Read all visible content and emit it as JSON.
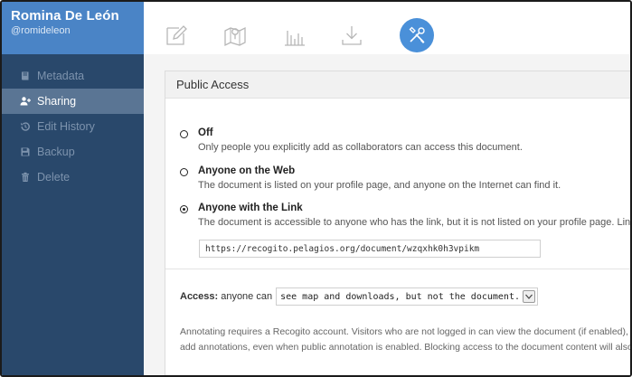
{
  "user": {
    "name": "Romina De León",
    "handle": "@romideleon"
  },
  "sidebar": {
    "items": [
      {
        "label": "Metadata",
        "icon": "book-icon",
        "active": false
      },
      {
        "label": "Sharing",
        "icon": "add-user-icon",
        "active": true
      },
      {
        "label": "Edit History",
        "icon": "history-icon",
        "active": false
      },
      {
        "label": "Backup",
        "icon": "floppy-disk-icon",
        "active": false
      },
      {
        "label": "Delete",
        "icon": "trash-icon",
        "active": false
      }
    ]
  },
  "toolbar": {
    "tools": [
      "edit-icon",
      "map-icon",
      "bar-chart-icon",
      "download-icon",
      "settings-tools-icon"
    ],
    "active_tool": "settings-tools-icon",
    "accent_color": "#4a90d9"
  },
  "panel": {
    "title": "Public Access",
    "options": [
      {
        "label": "Off",
        "description": "Only people you explicitly add as collaborators can access this document.",
        "checked": false
      },
      {
        "label": "Anyone on the Web",
        "description": "The document is listed on your profile page, and anyone on the Internet can find it.",
        "checked": false
      },
      {
        "label": "Anyone with the Link",
        "description": "The document is accessible to anyone who has the link, but it is not listed on your profile page. Link to share:",
        "checked": true
      }
    ],
    "share_link": "https://recogito.pelagios.org/document/wzqxhk0h3vpikm",
    "access": {
      "label_bold": "Access:",
      "label_rest": "anyone can",
      "selected": "see map and downloads, but not the document."
    },
    "footnote_line1": "Annotating requires a Recogito account. Visitors who are not logged in can view the document (if enabled), and downlo",
    "footnote_line2": "add annotations, even when public annotation is enabled. Blocking access to the document content will also limit som"
  },
  "colors": {
    "sidebar_bg": "#29486b",
    "user_header_bg": "#4a84c6",
    "active_item_bg": "#5a7594"
  }
}
